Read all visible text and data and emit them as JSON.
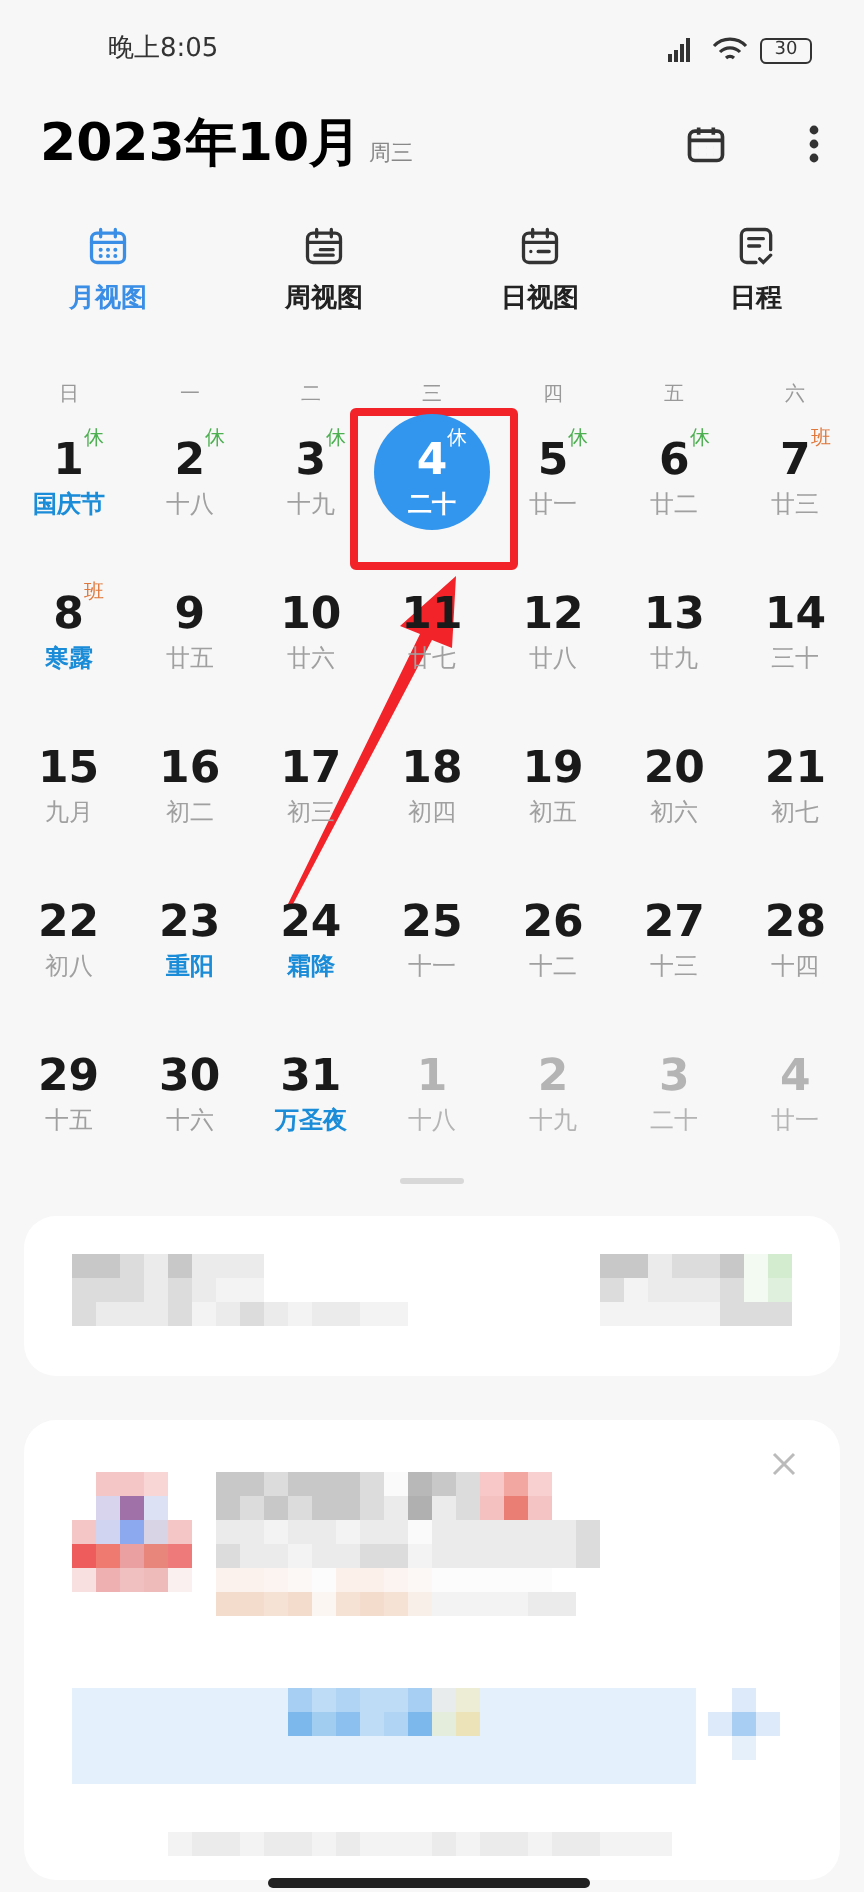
{
  "status_bar": {
    "time": "晚上8:05",
    "battery": "30"
  },
  "header": {
    "title": "2023年10月",
    "weekday": "周三"
  },
  "tabs": [
    {
      "label": "月视图",
      "selected": true
    },
    {
      "label": "周视图",
      "selected": false
    },
    {
      "label": "日视图",
      "selected": false
    },
    {
      "label": "日程",
      "selected": false
    }
  ],
  "weekdays": [
    "日",
    "一",
    "二",
    "三",
    "四",
    "五",
    "六"
  ],
  "days": [
    {
      "day": "1",
      "sub": "国庆节",
      "kind": "festival",
      "badge": {
        "text": "休",
        "kind": "rest"
      },
      "selected": false,
      "other_month": false
    },
    {
      "day": "2",
      "sub": "十八",
      "kind": "lunar",
      "badge": {
        "text": "休",
        "kind": "rest"
      },
      "selected": false,
      "other_month": false
    },
    {
      "day": "3",
      "sub": "十九",
      "kind": "lunar",
      "badge": {
        "text": "休",
        "kind": "rest"
      },
      "selected": false,
      "other_month": false
    },
    {
      "day": "4",
      "sub": "二十",
      "kind": "lunar",
      "badge": {
        "text": "休",
        "kind": "rest"
      },
      "selected": true,
      "other_month": false
    },
    {
      "day": "5",
      "sub": "廿一",
      "kind": "lunar",
      "badge": {
        "text": "休",
        "kind": "rest"
      },
      "selected": false,
      "other_month": false
    },
    {
      "day": "6",
      "sub": "廿二",
      "kind": "lunar",
      "badge": {
        "text": "休",
        "kind": "rest"
      },
      "selected": false,
      "other_month": false
    },
    {
      "day": "7",
      "sub": "廿三",
      "kind": "lunar",
      "badge": {
        "text": "班",
        "kind": "work"
      },
      "selected": false,
      "other_month": false
    },
    {
      "day": "8",
      "sub": "寒露",
      "kind": "festival",
      "badge": {
        "text": "班",
        "kind": "work"
      },
      "selected": false,
      "other_month": false
    },
    {
      "day": "9",
      "sub": "廿五",
      "kind": "lunar",
      "selected": false,
      "other_month": false
    },
    {
      "day": "10",
      "sub": "廿六",
      "kind": "lunar",
      "selected": false,
      "other_month": false
    },
    {
      "day": "11",
      "sub": "廿七",
      "kind": "lunar",
      "selected": false,
      "other_month": false
    },
    {
      "day": "12",
      "sub": "廿八",
      "kind": "lunar",
      "selected": false,
      "other_month": false
    },
    {
      "day": "13",
      "sub": "廿九",
      "kind": "lunar",
      "selected": false,
      "other_month": false
    },
    {
      "day": "14",
      "sub": "三十",
      "kind": "lunar",
      "selected": false,
      "other_month": false
    },
    {
      "day": "15",
      "sub": "九月",
      "kind": "lunar",
      "selected": false,
      "other_month": false
    },
    {
      "day": "16",
      "sub": "初二",
      "kind": "lunar",
      "selected": false,
      "other_month": false
    },
    {
      "day": "17",
      "sub": "初三",
      "kind": "lunar",
      "selected": false,
      "other_month": false
    },
    {
      "day": "18",
      "sub": "初四",
      "kind": "lunar",
      "selected": false,
      "other_month": false
    },
    {
      "day": "19",
      "sub": "初五",
      "kind": "lunar",
      "selected": false,
      "other_month": false
    },
    {
      "day": "20",
      "sub": "初六",
      "kind": "lunar",
      "selected": false,
      "other_month": false
    },
    {
      "day": "21",
      "sub": "初七",
      "kind": "lunar",
      "selected": false,
      "other_month": false
    },
    {
      "day": "22",
      "sub": "初八",
      "kind": "lunar",
      "selected": false,
      "other_month": false
    },
    {
      "day": "23",
      "sub": "重阳",
      "kind": "festival",
      "selected": false,
      "other_month": false
    },
    {
      "day": "24",
      "sub": "霜降",
      "kind": "festival",
      "selected": false,
      "other_month": false
    },
    {
      "day": "25",
      "sub": "十一",
      "kind": "lunar",
      "selected": false,
      "other_month": false
    },
    {
      "day": "26",
      "sub": "十二",
      "kind": "lunar",
      "selected": false,
      "other_month": false
    },
    {
      "day": "27",
      "sub": "十三",
      "kind": "lunar",
      "selected": false,
      "other_month": false
    },
    {
      "day": "28",
      "sub": "十四",
      "kind": "lunar",
      "selected": false,
      "other_month": false
    },
    {
      "day": "29",
      "sub": "十五",
      "kind": "lunar",
      "selected": false,
      "other_month": false
    },
    {
      "day": "30",
      "sub": "十六",
      "kind": "lunar",
      "selected": false,
      "other_month": false
    },
    {
      "day": "31",
      "sub": "万圣夜",
      "kind": "festival",
      "selected": false,
      "other_month": false
    },
    {
      "day": "1",
      "sub": "十八",
      "kind": "lunar",
      "selected": false,
      "other_month": true
    },
    {
      "day": "2",
      "sub": "十九",
      "kind": "lunar",
      "selected": false,
      "other_month": true
    },
    {
      "day": "3",
      "sub": "二十",
      "kind": "lunar",
      "selected": false,
      "other_month": true
    },
    {
      "day": "4",
      "sub": "廿一",
      "kind": "lunar",
      "selected": false,
      "other_month": true
    }
  ]
}
